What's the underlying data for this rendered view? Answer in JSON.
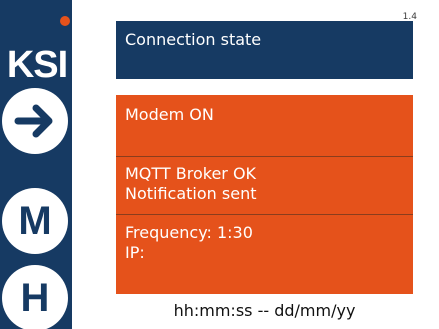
{
  "colors": {
    "sidebar": "#163a63",
    "panel_blue": "#163a63",
    "panel_orange": "#e5521b",
    "status_dot": "#e5521b",
    "text_on_panel": "#ffffff"
  },
  "sidebar": {
    "brand": "KSI",
    "status_indicator_icon": "orange-status-dot",
    "buttons": [
      {
        "icon": "right-arrow-icon"
      },
      {
        "label": "M"
      },
      {
        "label": "H"
      }
    ]
  },
  "header": {
    "page_number": "1.4",
    "title": "Connection state"
  },
  "status_panel": {
    "modem": "Modem ON",
    "mqtt": "MQTT Broker OK",
    "notification": "Notification sent",
    "frequency": "Frequency: 1:30",
    "ip": "IP:"
  },
  "footer": {
    "datetime_format": "hh:mm:ss -- dd/mm/yy"
  }
}
